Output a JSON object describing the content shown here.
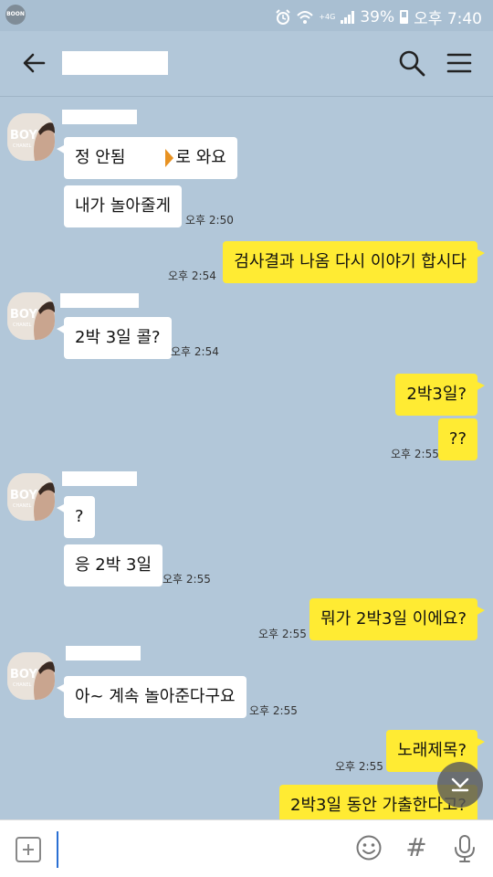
{
  "status_bar": {
    "app_badge": "BOON",
    "battery": "39%",
    "time": "오후 7:40",
    "wifi_tag": "+4G"
  },
  "header": {
    "chat_name": ""
  },
  "messages": [
    {
      "type": "in",
      "text_pre": "정 안됨",
      "text_post": "로 와요",
      "time": ""
    },
    {
      "type": "in",
      "text": "내가 놀아줄게",
      "time": "오후 2:50"
    },
    {
      "type": "out",
      "text": "검사결과 나옴 다시 이야기 합시다",
      "time": "오후 2:54"
    },
    {
      "type": "in",
      "text": "2박 3일 콜?",
      "time": "오후 2:54"
    },
    {
      "type": "out",
      "text": "2박3일?",
      "time": ""
    },
    {
      "type": "out",
      "text": "??",
      "time": "오후 2:55"
    },
    {
      "type": "in",
      "text": "?",
      "time": ""
    },
    {
      "type": "in",
      "text": "응 2박 3일",
      "time": "오후 2:55"
    },
    {
      "type": "out",
      "text": "뭐가 2박3일 이에요?",
      "time": "오후 2:55"
    },
    {
      "type": "in",
      "text": "아~ 계속 놀아준다구요",
      "time": "오후 2:55"
    },
    {
      "type": "out",
      "text": "노래제목?",
      "time": "오후 2:55"
    },
    {
      "type": "out",
      "text": "2박3일 동안 가출한다고?",
      "time": ""
    }
  ],
  "avatar": {
    "text_top": "BOY",
    "text_sub": "CHANEL"
  },
  "input": {
    "value": "",
    "placeholder": ""
  },
  "colors": {
    "background": "#b2c7d9",
    "outgoing": "#ffeb33",
    "incoming": "#ffffff"
  }
}
